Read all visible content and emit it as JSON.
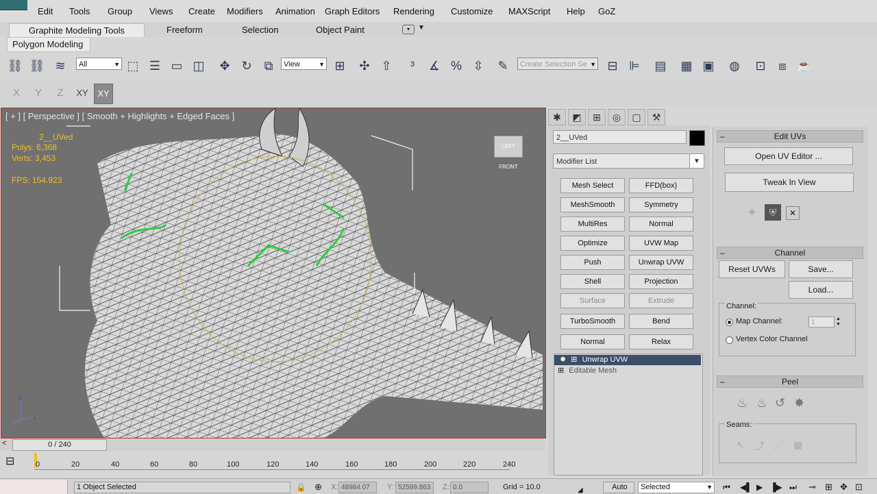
{
  "menu": [
    "Edit",
    "Tools",
    "Group",
    "Views",
    "Create",
    "Modifiers",
    "Animation",
    "Graph Editors",
    "Rendering",
    "Customize",
    "MAXScript",
    "Help",
    "GoZ"
  ],
  "ribbon": {
    "tabs": [
      "Graphite Modeling Tools",
      "Freeform",
      "Selection",
      "Object Paint"
    ],
    "sub_tab": "Polygon Modeling"
  },
  "toolbar": {
    "filter_select": "All",
    "ref_coord_select": "View",
    "selection_set_placeholder": "Create Selection Se"
  },
  "axes": [
    "X",
    "Y",
    "Z",
    "XY",
    "XY"
  ],
  "viewport": {
    "label": "[ + ] [ Perspective ] [ Smooth + Highlights + Edged Faces ]",
    "object_name": "2__UVed",
    "polys": "Polys: 6,368",
    "verts": "Verts: 3,453",
    "fps": "FPS:  154.923",
    "cube_label": "LEFT  FRONT"
  },
  "command_panel": {
    "object_name": "2__UVed",
    "color": "#000000",
    "modifier_list": "Modifier List",
    "modifiers": [
      "Mesh Select",
      "FFD(box)",
      "MeshSmooth",
      "Symmetry",
      "MultiRes",
      "Normal",
      "Optimize",
      "UVW Map",
      "Push",
      "Unwrap UVW",
      "Shell",
      "Projection",
      "Surface",
      "Extrude",
      "TurboSmooth",
      "Bend",
      "Normal",
      "Relax"
    ],
    "disabled": [
      "Surface",
      "Extrude"
    ],
    "stack": [
      "Unwrap UVW",
      "Editable Mesh"
    ]
  },
  "rollouts": {
    "edit_uvs": {
      "title": "Edit UVs",
      "open_editor": "Open UV Editor ...",
      "tweak": "Tweak In View"
    },
    "channel": {
      "title": "Channel",
      "reset": "Reset UVWs",
      "save": "Save...",
      "load": "Load...",
      "group_label": "Channel:",
      "map_channel": "Map Channel:",
      "map_channel_value": "1",
      "vertex_color": "Vertex Color Channel"
    },
    "peel": {
      "title": "Peel",
      "seams": "Seams:"
    }
  },
  "timeline": {
    "frame": "0 / 240",
    "ticks": [
      "0",
      "20",
      "40",
      "60",
      "80",
      "100",
      "120",
      "140",
      "160",
      "180",
      "200",
      "220",
      "240"
    ]
  },
  "status": {
    "selected": "1 Object Selected",
    "x_label": "X:",
    "x_value": "48984.07",
    "y_label": "Y:",
    "y_value": "52599.863",
    "z_label": "Z:",
    "z_value": "0.0",
    "grid": "Grid = 10.0",
    "auto": "Auto",
    "key_mode": "Selected"
  }
}
